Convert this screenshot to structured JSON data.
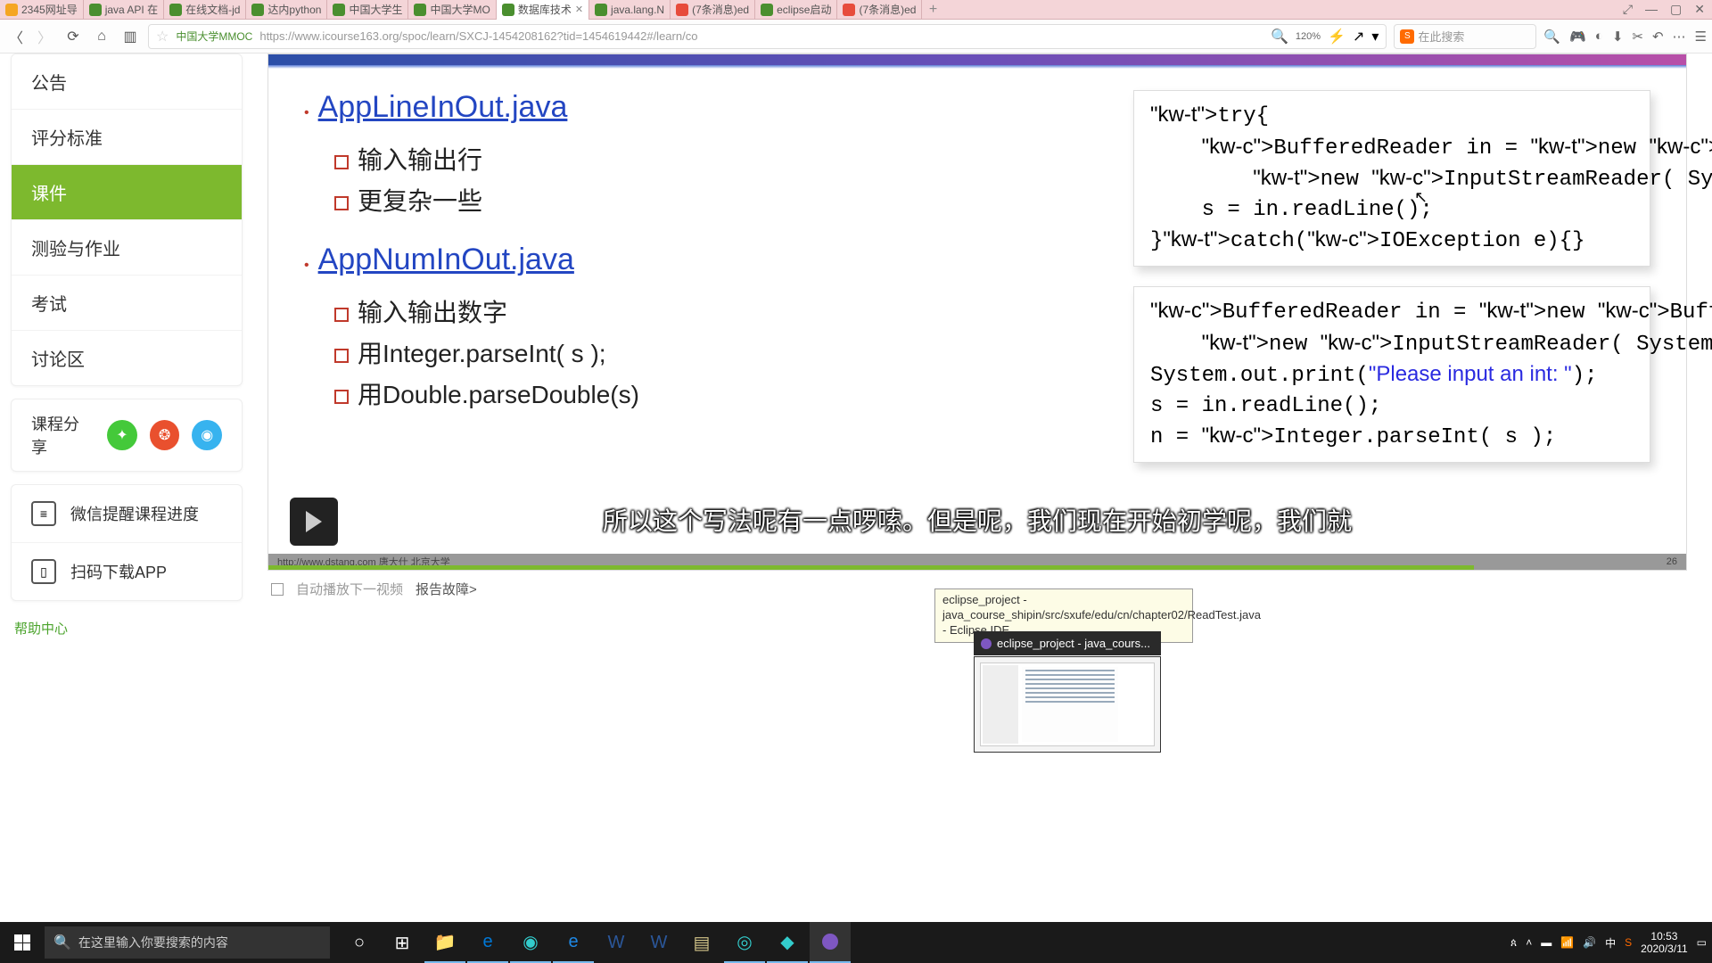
{
  "tabs": [
    {
      "label": "2345网址导",
      "icon": "#f5a623"
    },
    {
      "label": "java API 在",
      "icon": "#4a8f2f"
    },
    {
      "label": "在线文档-jd",
      "icon": "#4a8f2f"
    },
    {
      "label": "达内python",
      "icon": "#4a8f2f"
    },
    {
      "label": "中国大学生",
      "icon": "#4a8f2f"
    },
    {
      "label": "中国大学MO",
      "icon": "#4a8f2f"
    },
    {
      "label": "数据库技术",
      "icon": "#4a8f2f",
      "active": true
    },
    {
      "label": "java.lang.N",
      "icon": "#4a8f2f"
    },
    {
      "label": "(7条消息)ed",
      "icon": "#e74c3c"
    },
    {
      "label": "eclipse启动",
      "icon": "#4a8f2f"
    },
    {
      "label": "(7条消息)ed",
      "icon": "#e74c3c"
    }
  ],
  "url": {
    "site": "中国大学MMOC",
    "addr": "https://www.icourse163.org/spoc/learn/SXCJ-1454208162?tid=1454619442#/learn/co",
    "zoom": "120%"
  },
  "search_ph": "在此搜索",
  "sidebar": {
    "items": [
      "公告",
      "评分标准",
      "课件",
      "测验与作业",
      "考试",
      "讨论区"
    ],
    "active": 2,
    "share": "课程分享",
    "tool1": "微信提醒课程进度",
    "tool2": "扫码下载APP",
    "help": "帮助中心"
  },
  "slide": {
    "h1": "AppLineInOut.java",
    "s1a": "输入输出行",
    "s1b": "更复杂一些",
    "h2": "AppNumInOut.java",
    "s2a": "输入输出数字",
    "s2b": "用Integer.parseInt( s );",
    "s2c": "用Double.parseDouble(s)",
    "code1": "try{\n    BufferedReader in = new BufferedReader(\n        new InputStreamReader( System.in ) );\n    s = in.readLine();\n}catch(IOException e){}",
    "code2": "BufferedReader in = new BufferedReader(\n    new InputStreamReader( System.in ) );\nSystem.out.print(\"Please input an int: \");\ns = in.readLine();\nn = Integer.parseInt( s );",
    "footer_l": "http://www.dstang.com 唐大仕 北京大学",
    "footer_r": "26"
  },
  "caption": "所以这个写法呢有一点啰嗦。但是呢，我们现在开始初学呢，我们就",
  "below": {
    "auto": "自动播放下一视频",
    "fault": "报告故障>"
  },
  "tooltip": "eclipse_project - java_course_shipin/src/sxufe/edu/cn/chapter02/ReadTest.java - Eclipse IDE",
  "thumb_title": "eclipse_project - java_cours...",
  "taskbar": {
    "search": "在这里输入你要搜索的内容"
  },
  "tray": {
    "ime": "中",
    "time": "10:53",
    "date": "2020/3/11"
  }
}
